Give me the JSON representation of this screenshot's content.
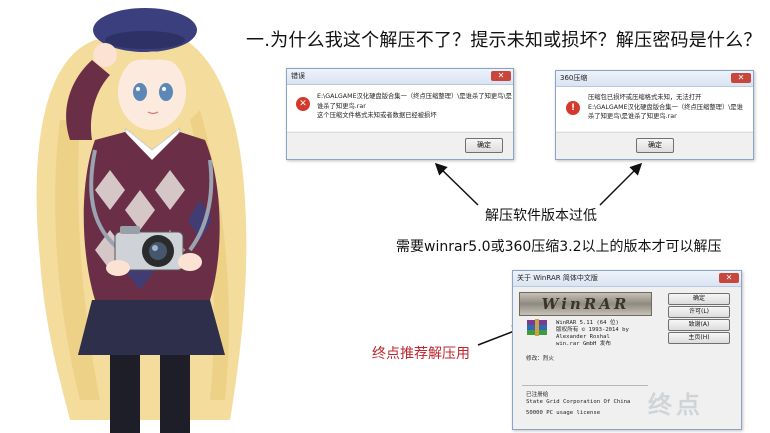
{
  "heading": "一.为什么我这个解压不了？提示未知或损坏？解压密码是什么？",
  "dialog_error": {
    "title": "错误",
    "close_symbol": "✕",
    "message": [
      "E:\\GALGAME汉化硬盘版合集一（终点压缩整理）\\是谁杀了知更鸟\\是",
      "谁杀了知更鸟.rar",
      "这个压缩文件格式未知或者数据已经被损坏"
    ],
    "ok_label": "确定"
  },
  "dialog_360": {
    "title": "360压缩",
    "close_symbol": "✕",
    "message": [
      "压缩包已损坏或压缩格式未知，无法打开",
      "E:\\GALGAME汉化硬盘版合集一（终点压缩整理）\\是谁",
      "杀了知更鸟\\是谁杀了知更鸟.rar"
    ],
    "ok_label": "确定"
  },
  "annotations": {
    "old_version": "解压软件版本过低",
    "need_version": "需要winrar5.0或360压缩3.2以上的版本才可以解压",
    "recommend": "终点推荐解压用"
  },
  "about_winrar": {
    "title": "关于 WinRAR 简体中文版",
    "close_symbol": "✕",
    "logo_text": "WinRAR",
    "lines": [
      "WinRAR 5.11 (64 位)",
      "版权所有 © 1993-2014 by",
      "Alexander Roshal",
      "win.rar GmbH 发布"
    ],
    "translator": "修改：烈火",
    "registered_label": "已注册给",
    "registered_to": "State Grid Corporation Of China",
    "license": "50000 PC usage license",
    "buttons": [
      "确定",
      "许可(L)",
      "致谢(A)",
      "主页(H)"
    ]
  },
  "watermark": "终点",
  "colors": {
    "error_red": "#d33a2c",
    "annotation_red": "#c0262d",
    "dialog_border": "#8aa4c4"
  }
}
